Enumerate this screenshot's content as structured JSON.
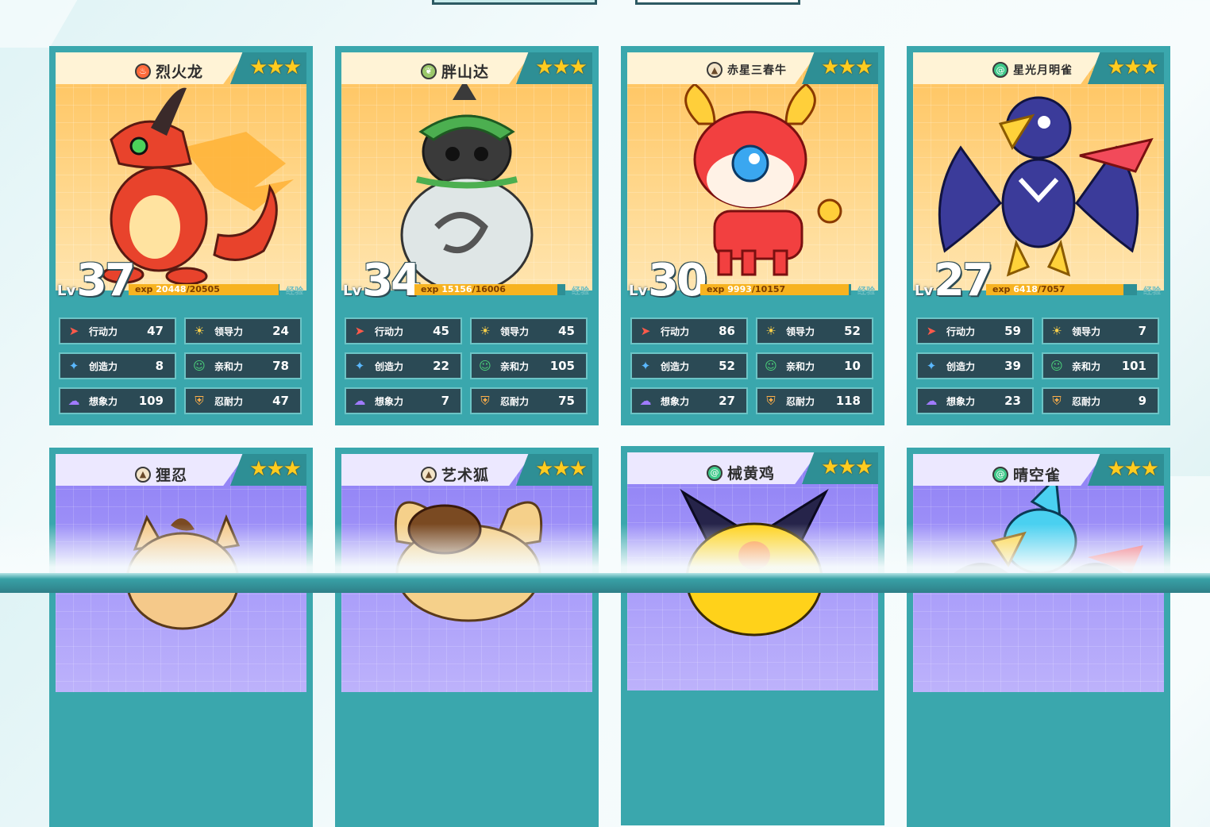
{
  "colors": {
    "card_frame": "#3aa7ad",
    "stat_bg": "#2b4a55",
    "exp_fill": "#f7b321",
    "star": "#ffcc1f"
  },
  "stat_labels": {
    "speed": "行动力",
    "lead": "领导力",
    "create": "创造力",
    "affinity": "亲和力",
    "imagine": "想象力",
    "endure": "忍耐力"
  },
  "lv_label": "Lv",
  "exp_prefix": "exp",
  "exp_button": "经验",
  "cards": [
    {
      "name": "烈火龙",
      "element": "fire-icon",
      "stars": "★★★",
      "level": "37",
      "exp_cur": "20448",
      "exp_max": "/20505",
      "exp_ratio": 0.997,
      "stats": {
        "speed": "47",
        "lead": "24",
        "create": "8",
        "affinity": "78",
        "imagine": "109",
        "endure": "47"
      }
    },
    {
      "name": "胖山达",
      "element": "leaf-icon",
      "stars": "★★★",
      "level": "34",
      "exp_cur": "15156",
      "exp_max": "/16006",
      "exp_ratio": 0.947,
      "stats": {
        "speed": "45",
        "lead": "45",
        "create": "22",
        "affinity": "105",
        "imagine": "7",
        "endure": "75"
      }
    },
    {
      "name": "赤星三春牛",
      "element": "ground-icon",
      "stars": "★★★",
      "level": "30",
      "exp_cur": "9993",
      "exp_max": "/10157",
      "exp_ratio": 0.984,
      "stats": {
        "speed": "86",
        "lead": "52",
        "create": "52",
        "affinity": "10",
        "imagine": "27",
        "endure": "118"
      }
    },
    {
      "name": "星光月明雀",
      "element": "wind-icon",
      "stars": "★★★",
      "level": "27",
      "exp_cur": "6418",
      "exp_max": "/7057",
      "exp_ratio": 0.909,
      "stats": {
        "speed": "59",
        "lead": "7",
        "create": "39",
        "affinity": "101",
        "imagine": "23",
        "endure": "9"
      }
    },
    {
      "name": "狸忍",
      "element": "ground-icon",
      "stars": "★★★"
    },
    {
      "name": "艺术狐",
      "element": "ground-icon",
      "stars": "★★★"
    },
    {
      "name": "械黄鸡",
      "element": "wind-icon",
      "stars": "★★★"
    },
    {
      "name": "晴空雀",
      "element": "wind-icon",
      "stars": "★★★"
    }
  ]
}
